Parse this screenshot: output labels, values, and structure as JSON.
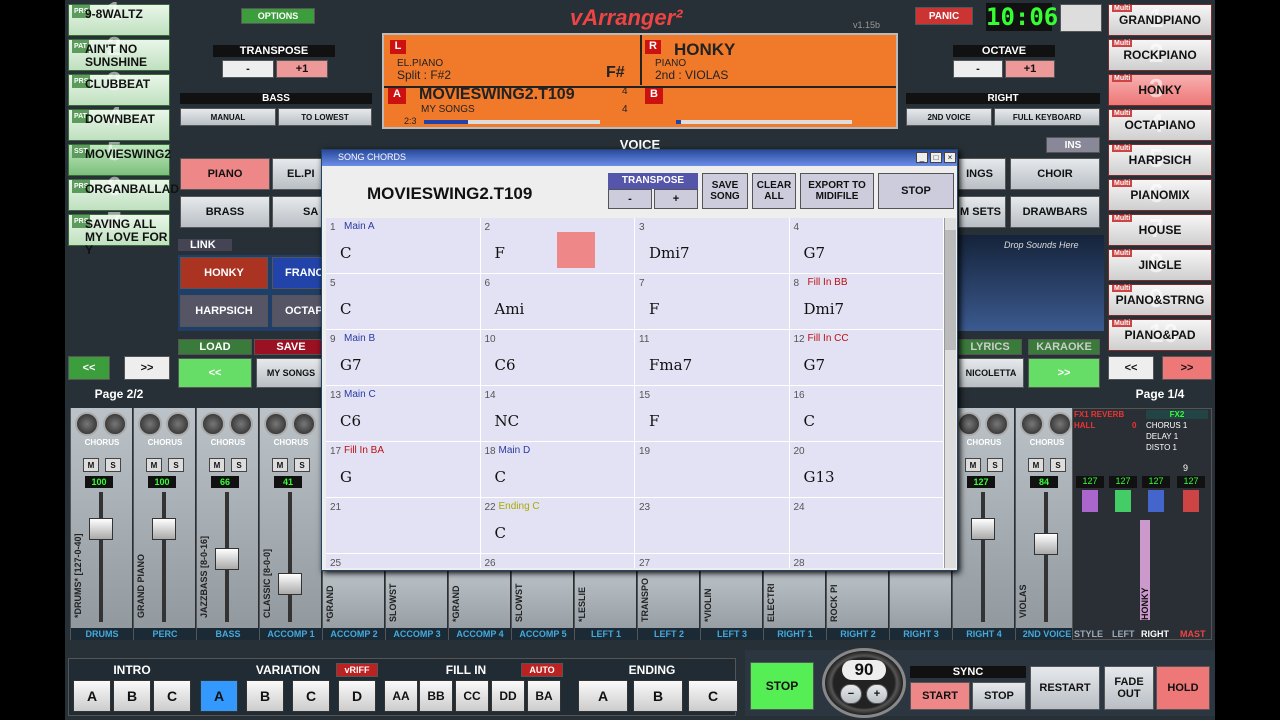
{
  "app": {
    "title": "vArranger²",
    "version": "v1.15b",
    "clock": "10:06",
    "panic": "PANIC",
    "options": "OPTIONS"
  },
  "left_slots": [
    {
      "tag": "PRS",
      "num": "1",
      "label": "9-8WALTZ"
    },
    {
      "tag": "PAT",
      "num": "2",
      "label": "AIN'T NO SUNSHINE"
    },
    {
      "tag": "PRS",
      "num": "3",
      "label": "CLUBBEAT"
    },
    {
      "tag": "PAT",
      "num": "4",
      "label": "DOWNBEAT"
    },
    {
      "tag": "SST",
      "num": "5",
      "label": "MOVIESWING2"
    },
    {
      "tag": "PRS",
      "num": "6",
      "label": "ORGANBALLAD"
    },
    {
      "tag": "PRS",
      "num": "7",
      "label": "SAVING ALL MY LOVE FOR Y"
    }
  ],
  "right_slots": [
    {
      "tag": "Multi",
      "num": "1",
      "label": "GRANDPIANO"
    },
    {
      "tag": "Multi",
      "num": "2",
      "label": "ROCKPIANO"
    },
    {
      "tag": "Multi",
      "num": "3",
      "label": "HONKY"
    },
    {
      "tag": "Multi",
      "num": "4",
      "label": "OCTAPIANO"
    },
    {
      "tag": "Multi",
      "num": "5",
      "label": "HARPSICH"
    },
    {
      "tag": "Multi",
      "num": "6",
      "label": "PIANOMIX"
    },
    {
      "tag": "Multi",
      "num": "7",
      "label": "HOUSE"
    },
    {
      "tag": "Multi",
      "num": "8",
      "label": "JINGLE"
    },
    {
      "tag": "Multi",
      "num": "9",
      "label": "PIANO&STRNG"
    },
    {
      "tag": "Multi",
      "num": "10",
      "label": "PIANO&PAD"
    }
  ],
  "nav": {
    "prev": "<<",
    "next": ">>",
    "left_page": "Page 2/2",
    "right_page": "Page 1/4"
  },
  "transpose": {
    "label": "TRANSPOSE",
    "minus": "-",
    "plus": "+1"
  },
  "octave": {
    "label": "OCTAVE",
    "minus": "-",
    "plus": "+1"
  },
  "bass": {
    "label": "BASS",
    "manual": "MANUAL",
    "lowest": "TO LOWEST"
  },
  "right_panel": {
    "label": "RIGHT",
    "second": "2ND VOICE",
    "full": "FULL KEYBOARD"
  },
  "display": {
    "l_tag": "L",
    "l_voice": "EL.PIANO",
    "split": "Split : F#2",
    "key": "F#",
    "r_tag": "R",
    "r_voice": "HONKY",
    "r_cat": "PIANO",
    "r_second": "2nd : VIOLAS",
    "a_tag": "A",
    "style": "MOVIESWING2.T109",
    "timesig_top": "4",
    "timesig_bottom": "4",
    "folder": "MY SONGS",
    "pos": "2:3",
    "b_tag": "B"
  },
  "voice": {
    "title": "VOICE",
    "ins": "INS",
    "piano": "PIANO",
    "elpiano": "EL.PI",
    "brass": "BRASS",
    "sa": "SA",
    "strings": "INGS",
    "choir": "CHOIR",
    "drumsets": "M SETS",
    "drawbars": "DRAWBARS"
  },
  "link": {
    "label": "LINK",
    "drop": "Drop Sounds Here",
    "honky": "HONKY",
    "franc": "FRANC",
    "harpsich": "HARPSICH",
    "octap": "OCTAP",
    "n1": "1",
    "n2": "2",
    "r": "R",
    "l": "L"
  },
  "bottom_left": {
    "load": "LOAD",
    "save": "SAVE",
    "prev": "<<",
    "mysongs": "MY SONGS"
  },
  "bottom_right": {
    "lyrics": "LYRICS",
    "karaoke": "KARAOKE",
    "nicoletta": "NICOLETTA",
    "next": ">>"
  },
  "dialog": {
    "title": "SONG CHORDS",
    "song": "MOVIESWING2.T109",
    "transpose": "TRANSPOSE",
    "minus": "-",
    "plus": "+",
    "save": "SAVE SONG",
    "clear": "CLEAR ALL",
    "export": "EXPORT TO MIDIFILE",
    "stop": "STOP"
  },
  "cells": [
    {
      "n": "1",
      "sec": "Main A",
      "chord": "C"
    },
    {
      "n": "2",
      "sec": "",
      "chord": "F"
    },
    {
      "n": "3",
      "sec": "",
      "chord": "Dmi7"
    },
    {
      "n": "4",
      "sec": "",
      "chord": "G7"
    },
    {
      "n": "5",
      "sec": "",
      "chord": "C"
    },
    {
      "n": "6",
      "sec": "",
      "chord": "Ami"
    },
    {
      "n": "7",
      "sec": "",
      "chord": "F"
    },
    {
      "n": "8",
      "sec": "Fill In BB",
      "chord": "Dmi7"
    },
    {
      "n": "9",
      "sec": "Main B",
      "chord": "G7"
    },
    {
      "n": "10",
      "sec": "",
      "chord": "C6"
    },
    {
      "n": "11",
      "sec": "",
      "chord": "Fma7"
    },
    {
      "n": "12",
      "sec": "Fill In CC",
      "chord": "G7"
    },
    {
      "n": "13",
      "sec": "Main C",
      "chord": "C6"
    },
    {
      "n": "14",
      "sec": "",
      "chord": "NC"
    },
    {
      "n": "15",
      "sec": "",
      "chord": "F"
    },
    {
      "n": "16",
      "sec": "",
      "chord": "C"
    },
    {
      "n": "17",
      "sec": "Fill In BA",
      "chord": "G"
    },
    {
      "n": "18",
      "sec": "Main D",
      "chord": "C"
    },
    {
      "n": "19",
      "sec": "",
      "chord": ""
    },
    {
      "n": "20",
      "sec": "",
      "chord": "G13"
    },
    {
      "n": "21",
      "sec": "",
      "chord": ""
    },
    {
      "n": "22",
      "sec": "Ending C",
      "chord": "C"
    },
    {
      "n": "23",
      "sec": "",
      "chord": ""
    },
    {
      "n": "24",
      "sec": "",
      "chord": ""
    },
    {
      "n": "25",
      "sec": "",
      "chord": ""
    },
    {
      "n": "26",
      "sec": "",
      "chord": ""
    },
    {
      "n": "27",
      "sec": "",
      "chord": ""
    },
    {
      "n": "28",
      "sec": "",
      "chord": ""
    }
  ],
  "mixer": [
    {
      "fx": "CHORUS",
      "vol": "100",
      "vl": "*DRUMS* [127-0-40]",
      "name": "DRUMS"
    },
    {
      "fx": "CHORUS",
      "vol": "100",
      "vl": "GRAND PIANO",
      "name": "PERC"
    },
    {
      "fx": "CHORUS",
      "vol": "66",
      "vl": "JAZZBASS [8-0-16]",
      "name": "BASS"
    },
    {
      "fx": "CHORUS",
      "vol": "41",
      "vl": "CLASSIC [8-0-0]",
      "name": "ACCOMP 1"
    },
    {
      "fx": "",
      "vol": "",
      "vl": "*GRAND",
      "name": "ACCOMP 2"
    },
    {
      "fx": "",
      "vol": "",
      "vl": "SLOWST",
      "name": "ACCOMP 3"
    },
    {
      "fx": "",
      "vol": "",
      "vl": "*GRAND",
      "name": "ACCOMP 4"
    },
    {
      "fx": "",
      "vol": "",
      "vl": "SLOWST",
      "name": "ACCOMP 5"
    },
    {
      "fx": "",
      "vol": "",
      "vl": "*LESLIE",
      "name": "LEFT 1"
    },
    {
      "fx": "",
      "vol": "",
      "vl": "TRANSPO",
      "name": "LEFT 2"
    },
    {
      "fx": "",
      "vol": "",
      "vl": "*VIOLIN",
      "name": "LEFT 3"
    },
    {
      "fx": "",
      "vol": "",
      "vl": "ELECTRI",
      "name": "RIGHT 1"
    },
    {
      "fx": "",
      "vol": "",
      "vl": "ROCK PI",
      "name": "RIGHT 2"
    },
    {
      "fx": "",
      "vol": "",
      "vl": "",
      "name": "RIGHT 3"
    },
    {
      "fx": "CHORUS",
      "vol": "127",
      "vl": "",
      "name": "RIGHT 4"
    },
    {
      "fx": "CHORUS",
      "vol": "84",
      "vl": "VIOLAS",
      "name": "2ND VOICE"
    }
  ],
  "fxpanel": {
    "fx1": "FX1 REVERB",
    "hall": "HALL",
    "hallv": "0",
    "fx2": "FX2",
    "c1": "CHORUS 1",
    "d1": "DELAY 1",
    "ds1": "DISTO 1",
    "v1": "127",
    "v2": "127",
    "v3": "127",
    "v4": "127",
    "nine": "9",
    "honky": "HONKY",
    "style": "STYLE",
    "left": "LEFT",
    "right": "RIGHT",
    "mast": "MAST"
  },
  "bottom": {
    "intro": "INTRO",
    "variation": "VARIATION",
    "vriff": "vRIFF",
    "fillin": "FILL IN",
    "auto": "AUTO",
    "ending": "ENDING",
    "intro_btns": [
      "A",
      "B",
      "C"
    ],
    "var_btns": [
      "A",
      "B",
      "C",
      "D"
    ],
    "fill_btns": [
      "AA",
      "BB",
      "CC",
      "DD",
      "BA"
    ],
    "end_btns": [
      "A",
      "B",
      "C"
    ],
    "stop": "STOP",
    "tempo": "90",
    "tminus": "−",
    "tplus": "+",
    "sync": "SYNC",
    "start": "START",
    "sstop": "STOP",
    "restart": "RESTART",
    "fadeout": "FADE OUT",
    "hold": "HOLD"
  }
}
